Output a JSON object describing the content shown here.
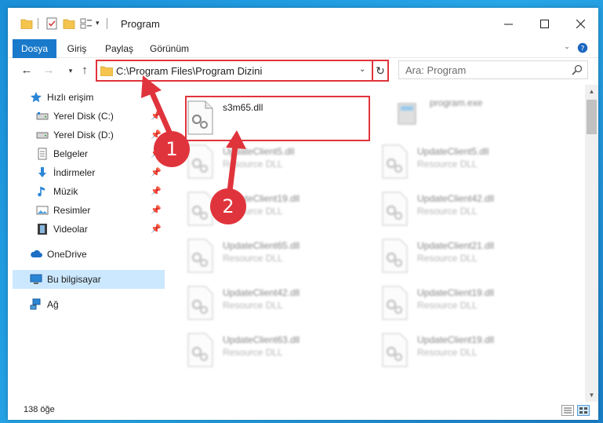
{
  "window": {
    "title": "Program"
  },
  "ribbon": {
    "tabs": [
      "Dosya",
      "Giriş",
      "Paylaş",
      "Görünüm"
    ]
  },
  "nav": {
    "address": "C:\\Program Files\\Program Dizini",
    "search_placeholder": "Ara: Program"
  },
  "sidebar": {
    "items": [
      {
        "label": "Hızlı erişim",
        "icon": "star-icon"
      },
      {
        "label": "Yerel Disk (C:)",
        "icon": "drive-icon",
        "pinned": true
      },
      {
        "label": "Yerel Disk (D:)",
        "icon": "drive-icon",
        "pinned": true
      },
      {
        "label": "Belgeler",
        "icon": "documents-icon",
        "pinned": true
      },
      {
        "label": "İndirmeler",
        "icon": "download-icon",
        "pinned": true
      },
      {
        "label": "Müzik",
        "icon": "music-icon",
        "pinned": true
      },
      {
        "label": "Resimler",
        "icon": "pictures-icon",
        "pinned": true
      },
      {
        "label": "Videolar",
        "icon": "videos-icon",
        "pinned": true
      },
      {
        "label": "OneDrive",
        "icon": "cloud-icon"
      },
      {
        "label": "Bu bilgisayar",
        "icon": "computer-icon",
        "selected": true
      },
      {
        "label": "Ağ",
        "icon": "network-icon"
      }
    ]
  },
  "files": [
    {
      "name": "s3m65.dll",
      "desc": "",
      "highlighted": true,
      "blurred": false
    },
    {
      "name": "program.exe",
      "desc": "",
      "blurred": true
    },
    {
      "name": "UpdateClient5.dll",
      "desc": "Resource DLL",
      "blurred": true
    },
    {
      "name": "UpdateClient5.dll",
      "desc": "Resource DLL",
      "blurred": true
    },
    {
      "name": "UpdateClient19.dll",
      "desc": "Resource DLL",
      "blurred": true
    },
    {
      "name": "UpdateClient42.dll",
      "desc": "Resource DLL",
      "blurred": true
    },
    {
      "name": "UpdateClient65.dll",
      "desc": "Resource DLL",
      "blurred": true
    },
    {
      "name": "UpdateClient21.dll",
      "desc": "Resource DLL",
      "blurred": true
    },
    {
      "name": "UpdateClient42.dll",
      "desc": "Resource DLL",
      "blurred": true
    },
    {
      "name": "UpdateClient19.dll",
      "desc": "Resource DLL",
      "blurred": true
    },
    {
      "name": "UpdateClient63.dll",
      "desc": "Resource DLL",
      "blurred": true
    },
    {
      "name": "UpdateClient19.dll",
      "desc": "Resource DLL",
      "blurred": true
    }
  ],
  "status": {
    "item_count": "138 öğe"
  },
  "annotations": {
    "badge_1": "1",
    "badge_2": "2",
    "color": "#e0343c"
  },
  "colors": {
    "accent": "#1979ca",
    "selection": "#cce8ff",
    "highlight": "#e0343c"
  }
}
